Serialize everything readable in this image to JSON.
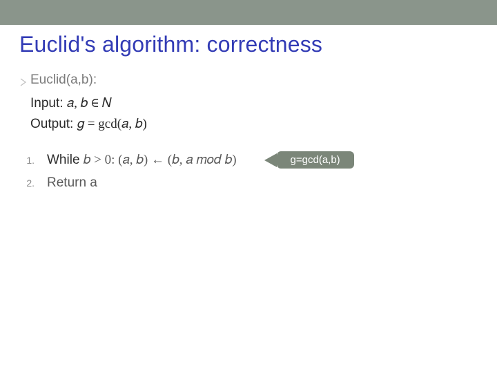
{
  "header": {
    "title": "Euclid's algorithm: correctness"
  },
  "spec": {
    "name_label": "Euclid(a,b):",
    "input_label": "Input:",
    "input_math": "𝑎, 𝑏 ∈ 𝑁",
    "output_label": "Output:",
    "output_math": "𝑔 = gcd(𝑎, 𝑏)"
  },
  "steps": {
    "s1_num": "1.",
    "s1_keyword": "While",
    "s1_math": "𝑏 > 0: (𝑎, 𝑏) ← (𝑏, 𝑎 𝑚𝑜𝑑 𝑏)",
    "s2_num": "2.",
    "s2_body": "Return a"
  },
  "callout": {
    "text": "g=gcd(a,b)"
  }
}
